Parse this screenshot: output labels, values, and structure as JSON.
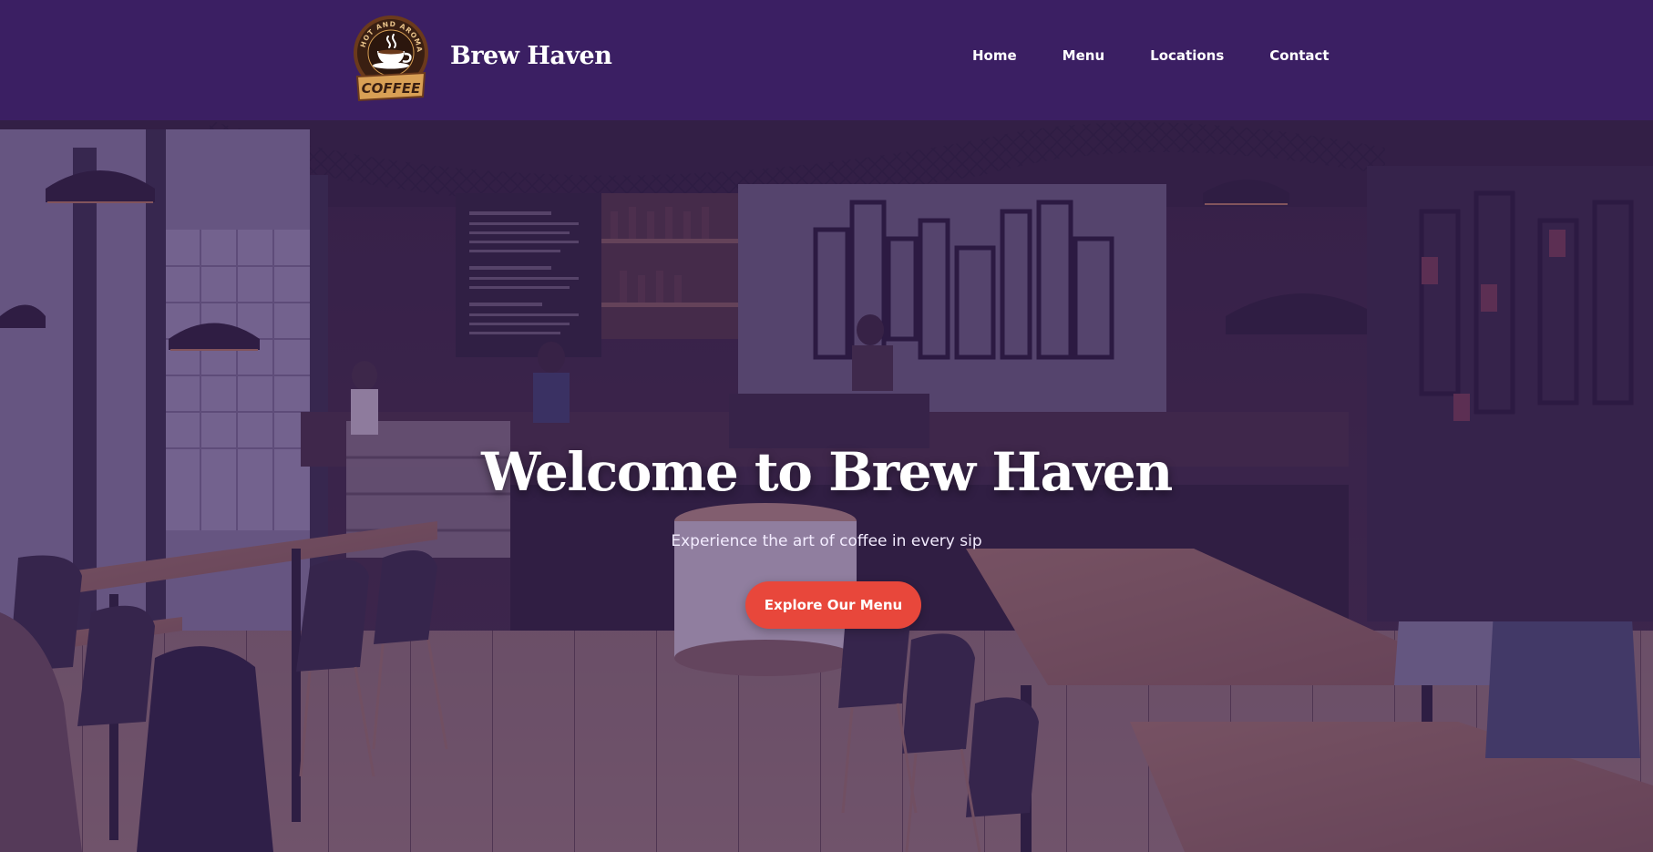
{
  "header": {
    "brand_name": "Brew Haven",
    "logo": {
      "arc_text": "HOT AND AROMATIC",
      "word": "COFFEE",
      "icon": "coffee-cup-icon"
    },
    "nav": [
      {
        "label": "Home"
      },
      {
        "label": "Menu"
      },
      {
        "label": "Locations"
      },
      {
        "label": "Contact"
      }
    ]
  },
  "hero": {
    "title": "Welcome to Brew Haven",
    "subtitle": "Experience the art of coffee in every sip",
    "cta_label": "Explore Our Menu"
  },
  "colors": {
    "header_bg": "#3b1f63",
    "overlay": "#42246c",
    "accent": "#e8473b",
    "logo_gold": "#d9a055",
    "logo_brown": "#6b3a1c"
  }
}
